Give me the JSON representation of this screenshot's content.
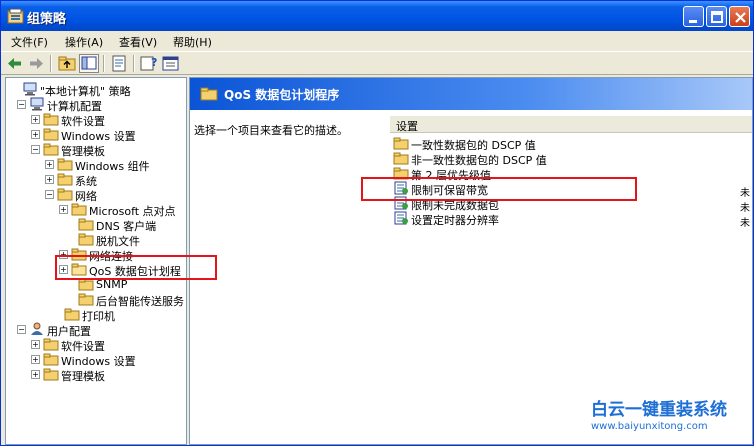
{
  "window": {
    "title": "组策略"
  },
  "menu": [
    "文件(F)",
    "操作(A)",
    "查看(V)",
    "帮助(H)"
  ],
  "tree": [
    {
      "label": "\"本地计算机\" 策略",
      "icon": "computer-icon",
      "box": ""
    },
    {
      "label": "计算机配置",
      "icon": "computer-icon",
      "box": "−"
    },
    {
      "label": "软件设置",
      "icon": "folder-icon",
      "box": "+"
    },
    {
      "label": "Windows 设置",
      "icon": "folder-icon",
      "box": "+"
    },
    {
      "label": "管理模板",
      "icon": "folder-icon",
      "box": "−"
    },
    {
      "label": "Windows 组件",
      "icon": "folder-icon",
      "box": "+"
    },
    {
      "label": "系统",
      "icon": "folder-icon",
      "box": "+"
    },
    {
      "label": "网络",
      "icon": "folder-icon",
      "box": "−"
    },
    {
      "label": "Microsoft 点对点",
      "icon": "folder-icon",
      "box": "+"
    },
    {
      "label": "DNS 客户端",
      "icon": "folder-icon",
      "box": ""
    },
    {
      "label": "脱机文件",
      "icon": "folder-icon",
      "box": ""
    },
    {
      "label": "网络连接",
      "icon": "folder-icon",
      "box": "+"
    },
    {
      "label": "QoS 数据包计划程",
      "icon": "folder-open-icon",
      "box": "+"
    },
    {
      "label": "SNMP",
      "icon": "folder-icon",
      "box": ""
    },
    {
      "label": "后台智能传送服务",
      "icon": "folder-icon",
      "box": ""
    },
    {
      "label": "打印机",
      "icon": "folder-icon",
      "box": ""
    },
    {
      "label": "用户配置",
      "icon": "user-icon",
      "box": "−"
    },
    {
      "label": "软件设置",
      "icon": "folder-icon",
      "box": "+"
    },
    {
      "label": "Windows 设置",
      "icon": "folder-icon",
      "box": "+"
    },
    {
      "label": "管理模板",
      "icon": "folder-icon",
      "box": "+"
    }
  ],
  "right": {
    "title": "QoS 数据包计划程序",
    "description": "选择一个项目来查看它的描述。",
    "column": "设置",
    "items": [
      {
        "label": "一致性数据包的 DSCP 值",
        "icon": "folder-icon"
      },
      {
        "label": "非一致性数据包的 DSCP 值",
        "icon": "folder-icon"
      },
      {
        "label": "第 2 层优先级值",
        "icon": "folder-icon"
      },
      {
        "label": "限制可保留带宽",
        "icon": "policy-icon"
      },
      {
        "label": "限制未完成数据包",
        "icon": "policy-icon"
      },
      {
        "label": "设置定时器分辨率",
        "icon": "policy-icon"
      }
    ],
    "edge_marks": [
      "未",
      "未",
      "未"
    ]
  },
  "watermark": {
    "title": "白云一键重装系统",
    "url": "www.baiyunxitong.com"
  },
  "colors": {
    "highlight_box": "#e4141b",
    "title_bar": "#0054e3",
    "watermark": "#1d6fd6"
  }
}
